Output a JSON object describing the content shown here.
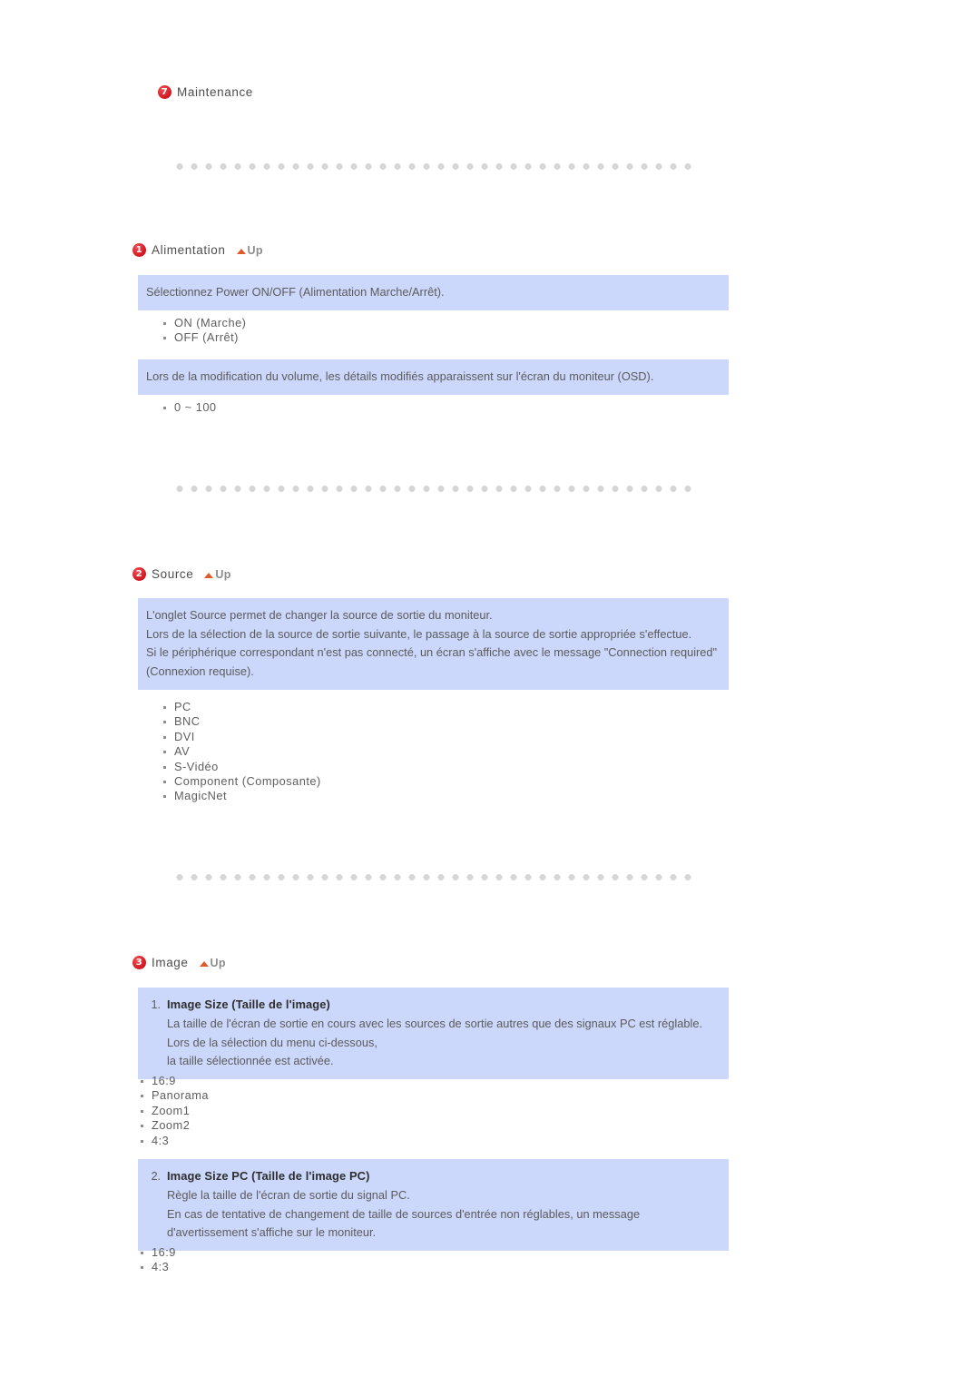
{
  "page": {
    "heading": {
      "badge": "7",
      "title": "Maintenance"
    },
    "up_label": "Up"
  },
  "sections": [
    {
      "badge": "1",
      "title": "Alimentation",
      "boxes": [
        {
          "lines": [
            "Sélectionnez Power ON/OFF (Alimentation Marche/Arrêt)."
          ]
        }
      ],
      "bullets_1": [
        "ON (Marche)",
        "OFF (Arrêt)"
      ],
      "box_2": {
        "lines": [
          "Lors de la modification du volume, les détails modifiés apparaissent sur l'écran du moniteur (OSD)."
        ]
      },
      "bullets_2": [
        "0 ~ 100"
      ]
    },
    {
      "badge": "2",
      "title": "Source",
      "box": {
        "lines": [
          "L'onglet Source permet de changer la source de sortie du moniteur.",
          "Lors de la sélection de la source de sortie suivante, le passage à la source de sortie appropriée s'effectue.",
          "Si le périphérique correspondant n'est pas connecté, un écran s'affiche avec le message \"Connection required\" (Connexion requise)."
        ]
      },
      "bullets": [
        "PC",
        "BNC",
        "DVI",
        "AV",
        "S-Vidéo",
        "Component (Composante)",
        "MagicNet"
      ]
    },
    {
      "badge": "3",
      "title": "Image",
      "item_1": {
        "index": "1.",
        "title": "Image Size (Taille de l'image)",
        "lines": [
          "La taille de l'écran de sortie en cours avec les sources de sortie autres que des signaux PC est réglable. Lors de la sélection du menu ci-dessous,",
          "la taille sélectionnée est activée."
        ]
      },
      "bullets_1": [
        "16:9",
        "Panorama",
        "Zoom1",
        "Zoom2",
        "4:3"
      ],
      "item_2": {
        "index": "2.",
        "title": "Image Size PC (Taille de l'image PC)",
        "lines": [
          "Règle la taille de l'écran de sortie du signal PC.",
          "En cas de tentative de changement de taille de sources d'entrée non réglables, un message d'avertissement s'affiche sur le moniteur."
        ]
      },
      "bullets_2": [
        "16:9",
        "4:3"
      ]
    }
  ],
  "colors": {
    "box_background": "#ccd8fb",
    "badge_red": "#d8232a",
    "up_arrow": "#e05a28",
    "text": "#5a5a5a",
    "dot_separator": "#d6d6d6"
  }
}
